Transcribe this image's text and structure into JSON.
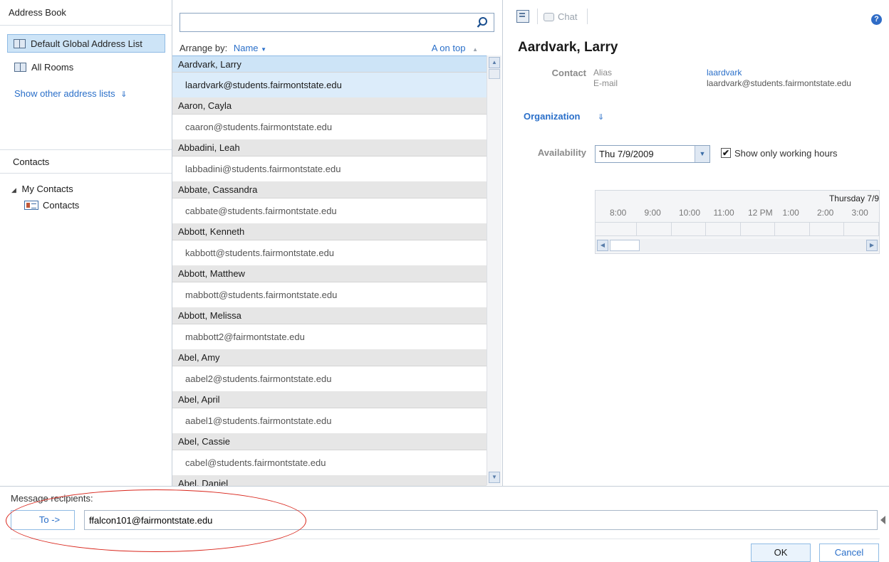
{
  "left": {
    "address_book_header": "Address Book",
    "lists": [
      {
        "label": "Default Global Address List"
      },
      {
        "label": "All Rooms"
      }
    ],
    "show_other": "Show other address lists",
    "contacts_header": "Contacts",
    "my_contacts": "My Contacts",
    "contacts_folder": "Contacts"
  },
  "middle": {
    "search": {
      "value": "",
      "placeholder": ""
    },
    "arrange_label": "Arrange by:",
    "arrange_value": "Name",
    "sort_order": "A on top",
    "entries": [
      {
        "name": "Aardvark, Larry",
        "email": "laardvark@students.fairmontstate.edu"
      },
      {
        "name": "Aaron, Cayla",
        "email": "caaron@students.fairmontstate.edu"
      },
      {
        "name": "Abbadini, Leah",
        "email": "labbadini@students.fairmontstate.edu"
      },
      {
        "name": "Abbate, Cassandra",
        "email": "cabbate@students.fairmontstate.edu"
      },
      {
        "name": "Abbott, Kenneth",
        "email": "kabbott@students.fairmontstate.edu"
      },
      {
        "name": "Abbott, Matthew",
        "email": "mabbott@students.fairmontstate.edu"
      },
      {
        "name": "Abbott, Melissa",
        "email": "mabbott2@fairmontstate.edu"
      },
      {
        "name": "Abel, Amy",
        "email": "aabel2@students.fairmontstate.edu"
      },
      {
        "name": "Abel, April",
        "email": "aabel1@students.fairmontstate.edu"
      },
      {
        "name": "Abel, Cassie",
        "email": "cabel@students.fairmontstate.edu"
      },
      {
        "name": "Abel, Daniel",
        "email": ""
      }
    ]
  },
  "right": {
    "chat_label": "Chat",
    "help": "?",
    "contact_name": "Aardvark, Larry",
    "contact_section": "Contact",
    "alias_label": "Alias",
    "alias_value": "laardvark",
    "email_label": "E-mail",
    "email_value": "laardvark@students.fairmontstate.edu",
    "organization": "Organization",
    "availability_label": "Availability",
    "availability_date": "Thu 7/9/2009",
    "working_hours_label": "Show only working hours",
    "working_hours_checked": true,
    "timeline_day": "Thursday 7/9",
    "timeline_hours": [
      "8:00",
      "9:00",
      "10:00",
      "11:00",
      "12 PM",
      "1:00",
      "2:00",
      "3:00"
    ]
  },
  "bottom": {
    "message_recipients": "Message recipients:",
    "to_button": "To ->",
    "to_value": "ffalcon101@fairmontstate.edu",
    "ok": "OK",
    "cancel": "Cancel"
  },
  "colors": {
    "accent": "#2a6fc9",
    "selection": "#cde4f7",
    "annotation": "#d9261c"
  }
}
